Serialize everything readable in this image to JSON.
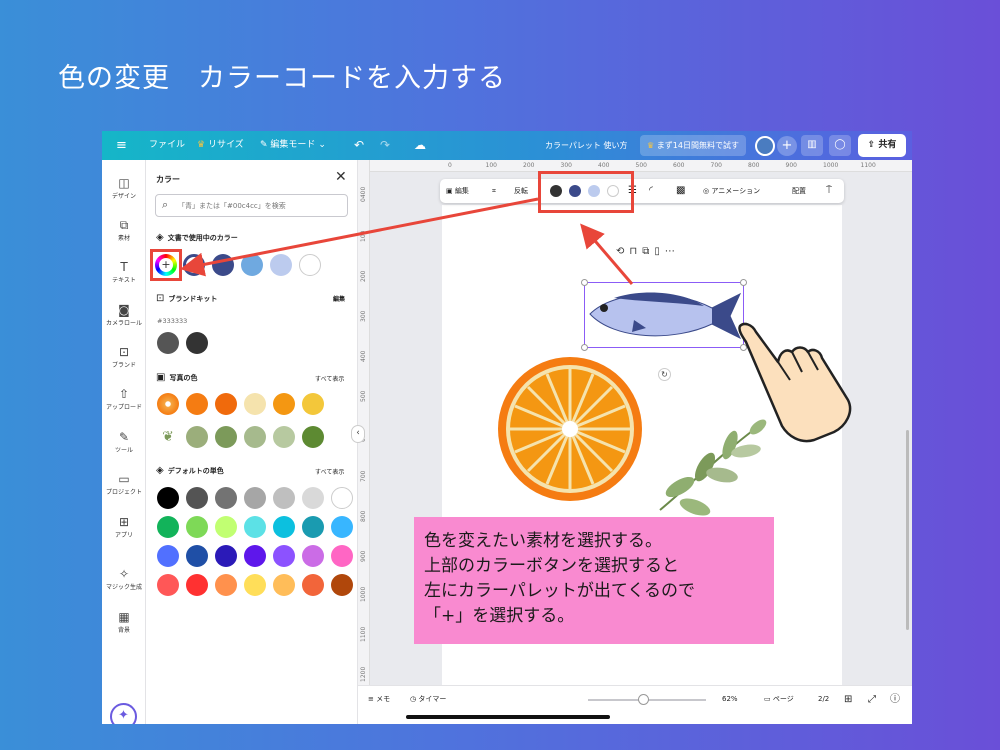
{
  "slide": {
    "title": "色の変更　カラーコードを入力する"
  },
  "topbar": {
    "menu_icon": "hamburger-icon",
    "file": "ファイル",
    "resize": "リサイズ",
    "edit_mode": "編集モード",
    "doc_title": "カラーパレット 使い方",
    "trial": "まず14日間無料で試す",
    "share": "共有"
  },
  "rail": {
    "items": [
      {
        "label": "デザイン",
        "icon": "layout-icon"
      },
      {
        "label": "素材",
        "icon": "elements-icon"
      },
      {
        "label": "テキスト",
        "icon": "text-icon"
      },
      {
        "label": "カメラロール",
        "icon": "camera-icon"
      },
      {
        "label": "ブランド",
        "icon": "brand-icon"
      },
      {
        "label": "アップロード",
        "icon": "upload-icon"
      },
      {
        "label": "ツール",
        "icon": "pen-icon"
      },
      {
        "label": "プロジェクト",
        "icon": "folder-icon"
      },
      {
        "label": "アプリ",
        "icon": "apps-icon"
      },
      {
        "label": "マジック生成",
        "icon": "magic-icon"
      },
      {
        "label": "背景",
        "icon": "pattern-icon"
      }
    ]
  },
  "panel": {
    "title": "カラー",
    "search_placeholder": "「青」または「#00c4cc」を検索",
    "doc_colors_title": "文書で使用中のカラー",
    "doc_colors": [
      "#ffffff",
      "#3b4a8a",
      "#6fa9e0",
      "#bccbee",
      "#ffffff"
    ],
    "brand_kit_title": "ブランドキット",
    "brand_kit_edit": "編集",
    "brand_hex": "#333333",
    "brand_colors": [
      "#555555",
      "#333333"
    ],
    "photo_title": "写真の色",
    "photo_show_all": "すべて表示",
    "photo_row1": [
      "#f57c12",
      "#f06a0c",
      "#f5e3ad",
      "#f49712",
      "#f3c73a"
    ],
    "photo_row2": [
      "#9bae7b",
      "#7c9a5a",
      "#a6ba8d",
      "#b7c9a0",
      "#5d8a32"
    ],
    "default_title": "デフォルトの単色",
    "default_show_all": "すべて表示",
    "default_colors": [
      [
        "#000000",
        "#545454",
        "#737373",
        "#a6a6a6",
        "#bfbfbf",
        "#d9d9d9",
        "#ffffff"
      ],
      [
        "#12b35a",
        "#7ed957",
        "#c1ff72",
        "#5ce1e6",
        "#0cc0df",
        "#1a9bb0",
        "#38b6ff"
      ],
      [
        "#5170ff",
        "#1f4fa6",
        "#2b1ab8",
        "#5e17eb",
        "#8c52ff",
        "#cb6ce6",
        "#ff66c4"
      ],
      [
        "#ff5757",
        "#ff3131",
        "#ff914d",
        "#ffde59",
        "#ffbd59",
        "#f2653a",
        "#b0470b"
      ]
    ]
  },
  "context_bar": {
    "edit": "編集",
    "flip": "反転",
    "colors": [
      "#333333",
      "#3b4a8a",
      "#bccbee",
      "#ffffff"
    ],
    "animation": "アニメーション",
    "position": "配置"
  },
  "ruler": {
    "top": [
      "0",
      "100",
      "200",
      "300",
      "400",
      "500",
      "600",
      "700",
      "800",
      "900",
      "1000",
      "1100"
    ],
    "left": [
      "0400",
      "100",
      "200",
      "300",
      "400",
      "500",
      "600",
      "700",
      "800",
      "900",
      "1000",
      "1100",
      "1200"
    ]
  },
  "bottombar": {
    "memo": "メモ",
    "timer": "タイマー",
    "zoom": "62%",
    "pages": "ページ",
    "page_count": "2/2"
  },
  "note": {
    "lines": [
      "色を変えたい素材を選択する。",
      "上部のカラーボタンを選択すると",
      "左にカラーパレットが出てくるので",
      "「+」を選択する。"
    ]
  }
}
